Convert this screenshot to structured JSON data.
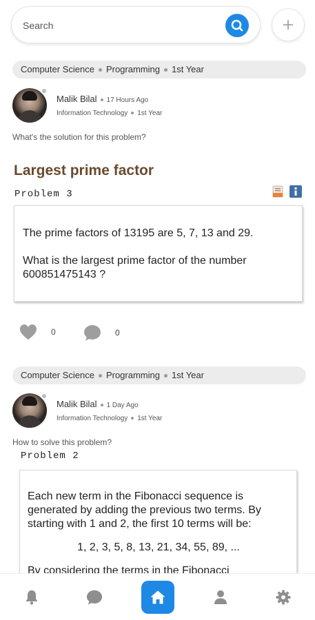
{
  "search": {
    "placeholder": "Search",
    "search_icon": "search-icon",
    "add_icon": "plus-icon"
  },
  "posts": [
    {
      "tags": [
        "Computer Science",
        "Programming",
        "1st Year"
      ],
      "author": "Malik Bilal",
      "time": "17 Hours Ago",
      "department": "Information Technology",
      "year": "1st Year",
      "question": "What's the solution for this problem?",
      "problem_title": "Largest prime factor",
      "problem_number": "Problem 3",
      "body_1": "The prime factors of 13195 are 5, 7, 13 and 29.",
      "body_2": "What is the largest prime factor of the number 600851475143 ?",
      "likes": "0",
      "comments": "0"
    },
    {
      "tags": [
        "Computer Science",
        "Programming",
        "1st Year"
      ],
      "author": "Malik Bilal",
      "time": "1 Day Ago",
      "department": "Information Technology",
      "year": "1st Year",
      "question": "How to solve this problem?",
      "problem_number": "Problem 2",
      "body_1": "Each new term in the Fibonacci sequence is generated by adding the previous two terms. By starting with 1 and 2, the first 10 terms will be:",
      "sequence": "1, 2, 3, 5, 8, 13, 21, 34, 55, 89, ...",
      "body_cut": "By considering the terms in the Fibonacci"
    }
  ],
  "nav": {
    "items": [
      "bell-icon",
      "chat-icon",
      "home-icon",
      "user-icon",
      "gear-icon"
    ],
    "active": "home-icon"
  },
  "colors": {
    "accent": "#1e88e5",
    "title": "#6b4a2e",
    "tag_bg": "#ececec"
  }
}
